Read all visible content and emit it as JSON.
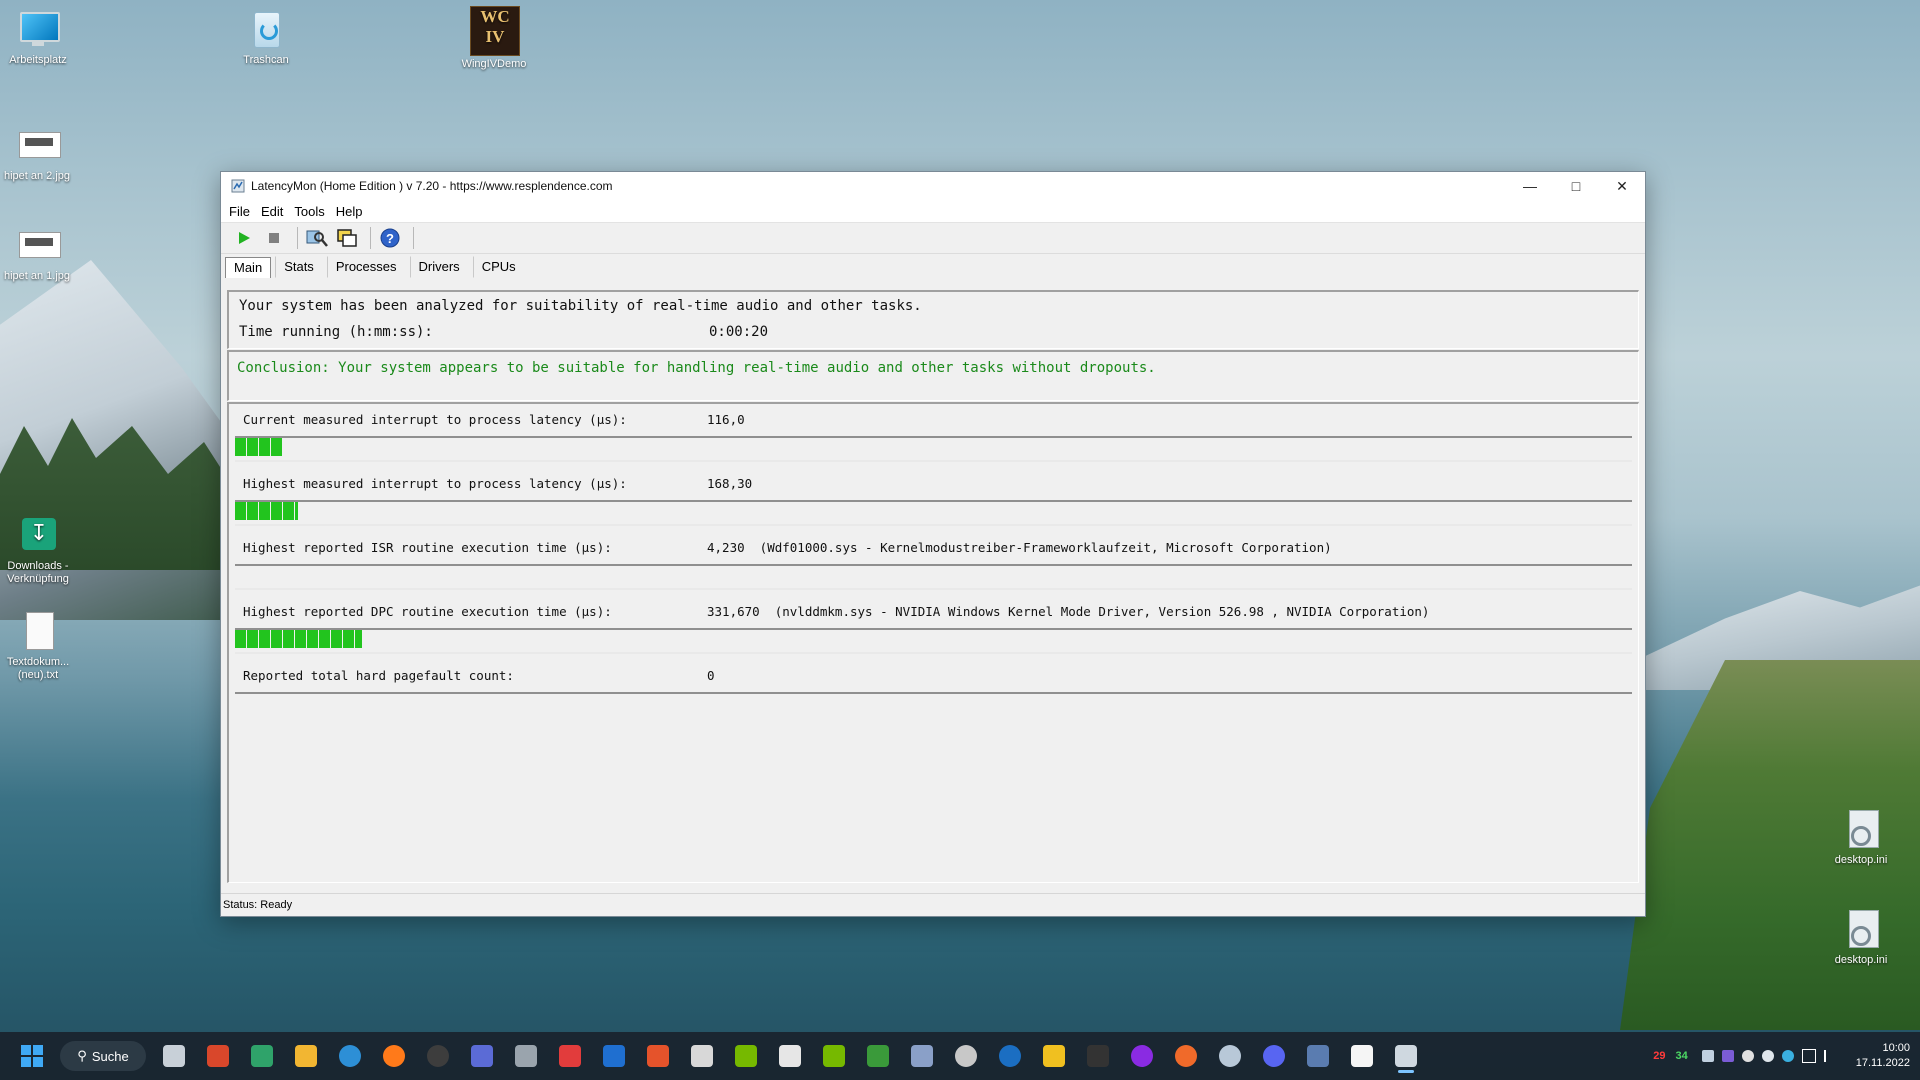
{
  "desktop": {
    "icons": [
      {
        "label": "Arbeitsplatz",
        "icon": "computer-icon"
      },
      {
        "label": "Trashcan",
        "icon": "recycle-bin-icon"
      },
      {
        "label": "WingIVDemo",
        "icon": "wing-commander-icon"
      },
      {
        "label": "hipet an 2.jpg",
        "icon": "image-file-icon"
      },
      {
        "label": "hipet an 1.jpg",
        "icon": "image-file-icon"
      },
      {
        "label": "Downloads - Verknüpfung",
        "icon": "downloads-shortcut-icon"
      },
      {
        "label": "Textdokum... (neu).txt",
        "icon": "text-file-icon"
      },
      {
        "label": "desktop.ini",
        "icon": "settings-file-icon"
      },
      {
        "label": "desktop.ini",
        "icon": "settings-file-icon"
      }
    ]
  },
  "window": {
    "title": "LatencyMon  (Home Edition ) v 7.20 - https://www.resplendence.com",
    "menu": [
      "File",
      "Edit",
      "Tools",
      "Help"
    ],
    "tabs": [
      "Main",
      "Stats",
      "Processes",
      "Drivers",
      "CPUs"
    ],
    "active_tab": "Main",
    "summary": {
      "line1": "Your system has been analyzed for suitability of real-time audio and other tasks.",
      "time_label": "Time running (h:mm:ss):",
      "time_value": "0:00:20"
    },
    "conclusion": "Conclusion: Your system appears to be suitable for handling real-time audio and other tasks without dropouts.",
    "metrics": [
      {
        "label": "Current measured interrupt to process latency (µs):",
        "value": "116,0",
        "level": 0.034
      },
      {
        "label": "Highest measured interrupt to process latency (µs):",
        "value": "168,30",
        "level": 0.045
      },
      {
        "label": "Highest reported ISR routine execution time (µs):",
        "value": "4,230  (Wdf01000.sys - Kernelmodustreiber-Frameworklaufzeit, Microsoft Corporation)",
        "level": 0
      },
      {
        "label": "Highest reported DPC routine execution time (µs):",
        "value": "331,670  (nvlddmkm.sys - NVIDIA Windows Kernel Mode Driver, Version 526.98 , NVIDIA Corporation)",
        "level": 0.091
      },
      {
        "label": "Reported total hard pagefault count:",
        "value": "0",
        "level": null
      }
    ],
    "status": "Status: Ready"
  },
  "taskbar": {
    "search_label": "Suche",
    "apps": [
      "task-view-icon",
      "app-red-icon",
      "app-green-icon",
      "file-explorer-icon",
      "edge-icon",
      "firefox-icon",
      "obs-icon",
      "save-icon",
      "clapper-icon",
      "anydesk-icon",
      "search-app-icon",
      "app-swirl-icon",
      "app-mask-icon",
      "nvidia-icon",
      "app-badge-icon",
      "geforce-icon",
      "app-bars-icon",
      "app-bird-icon",
      "steam-alt-icon",
      "steam-icon",
      "rockstar-icon",
      "epic-games-icon",
      "app-ring-icon",
      "origin-icon",
      "app-target-icon",
      "discord-icon",
      "app-car-icon",
      "notepad-icon",
      "latencymon-icon"
    ],
    "tray": {
      "temp1": "29",
      "temp2": "34",
      "time": "10:00",
      "date": "17.11.2022"
    },
    "colors": {
      "temp1": "#ff3b3b",
      "temp2": "#4cd964"
    }
  }
}
